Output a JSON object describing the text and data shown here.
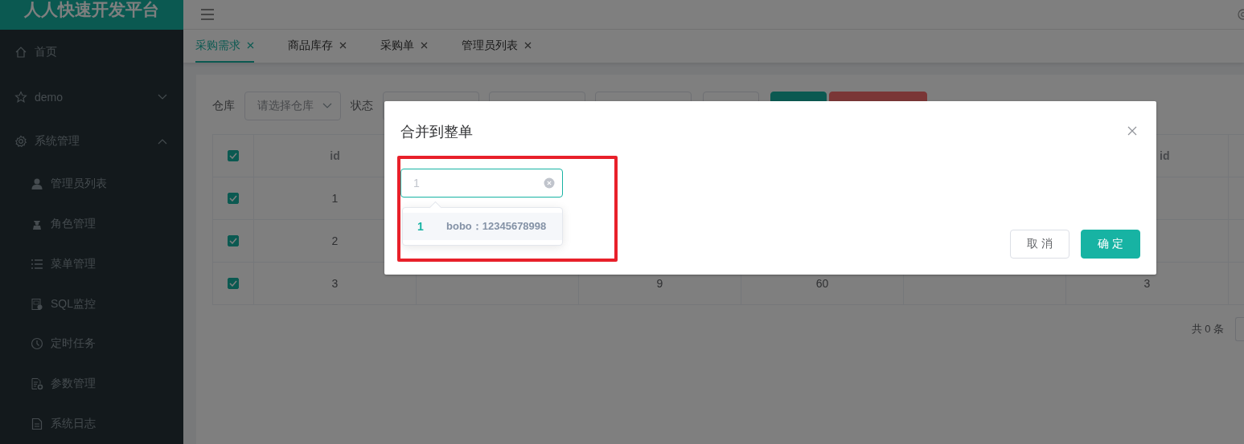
{
  "header": {
    "logo": "人人快速开发平台"
  },
  "sidebar": {
    "items": [
      {
        "label": "首页",
        "kind": "link"
      },
      {
        "label": "demo",
        "kind": "group",
        "expanded": false
      },
      {
        "label": "系统管理",
        "kind": "group",
        "expanded": true,
        "children": [
          {
            "label": "管理员列表"
          },
          {
            "label": "角色管理"
          },
          {
            "label": "菜单管理"
          },
          {
            "label": "SQL监控"
          },
          {
            "label": "定时任务"
          },
          {
            "label": "参数管理"
          },
          {
            "label": "系统日志"
          }
        ]
      }
    ]
  },
  "tabs": [
    {
      "label": "采购需求",
      "selected": true
    },
    {
      "label": "商品库存",
      "selected": false
    },
    {
      "label": "采购单",
      "selected": false
    },
    {
      "label": "管理员列表",
      "selected": false
    }
  ],
  "filters": [
    {
      "kind": "select",
      "label": "仓库",
      "placeholder": "请选择仓库"
    },
    {
      "kind": "select",
      "label": "状态"
    },
    {
      "kind": "select"
    },
    {
      "kind": "input"
    },
    {
      "kind": "button"
    },
    {
      "kind": "primary"
    },
    {
      "kind": "danger"
    }
  ],
  "table": {
    "columns": [
      "id",
      null,
      null,
      null,
      null,
      "id",
      null
    ],
    "all_checked": true,
    "rows": [
      {
        "checked": true,
        "cells": [
          "1",
          null,
          null,
          null,
          null,
          null,
          null
        ]
      },
      {
        "checked": true,
        "cells": [
          "2",
          null,
          null,
          null,
          null,
          null,
          null
        ]
      },
      {
        "checked": true,
        "cells": [
          "3",
          null,
          "9",
          "60",
          null,
          "3",
          null
        ]
      }
    ]
  },
  "pagination": {
    "total": "共 0 条"
  },
  "dialog": {
    "title": "合并到整单",
    "select": {
      "placeholder": "1",
      "focused": true
    },
    "options": [
      {
        "index": "1",
        "text": "bobo：12345678998",
        "hovered": true
      }
    ],
    "buttons": [
      {
        "label": "取 消",
        "kind": "default"
      },
      {
        "label": "确 定",
        "kind": "primary"
      }
    ]
  }
}
